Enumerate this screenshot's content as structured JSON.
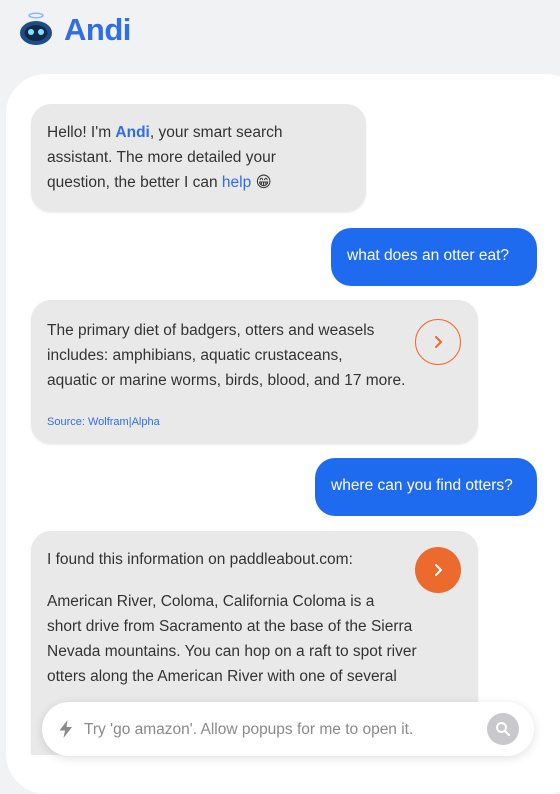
{
  "app": {
    "brand": "Andi"
  },
  "messages": {
    "greeting": {
      "part1": "Hello! I'm ",
      "andi": "Andi",
      "part2": ", your smart search",
      "line2": "assistant. The more detailed your",
      "line3": "question, the better I can ",
      "help": "help",
      "emoji": "😁"
    },
    "q1": "what does an otter eat?",
    "a1": {
      "lines": [
        "The primary diet of badgers, otters and weasels",
        "includes: amphibians, aquatic crustaceans,",
        "aquatic or marine worms, birds, blood, and 17 more."
      ],
      "source": "Source: Wolfram|Alpha"
    },
    "q2": "where can you find otters?",
    "a2": {
      "intro": "I found this information on paddleabout.com:",
      "lines": [
        "American River, Coloma, California Coloma is a",
        "short drive from Sacramento at the base of the Sierra",
        "Nevada mountains. You can hop on a raft to spot river",
        "otters along the American River with one of several"
      ]
    }
  },
  "input": {
    "placeholder": "Try 'go amazon'. Allow popups for me to open it."
  },
  "icons": {
    "logo": "robot-logo-icon",
    "next_outline": "chevron-right-icon",
    "next_filled": "chevron-right-icon",
    "bolt": "lightning-bolt-icon",
    "search": "search-icon"
  },
  "colors": {
    "brand": "#2f6ee8",
    "user_bubble": "#1f6bf0",
    "accent": "#ec6a2c",
    "bot_bubble": "#e9e9ea"
  }
}
